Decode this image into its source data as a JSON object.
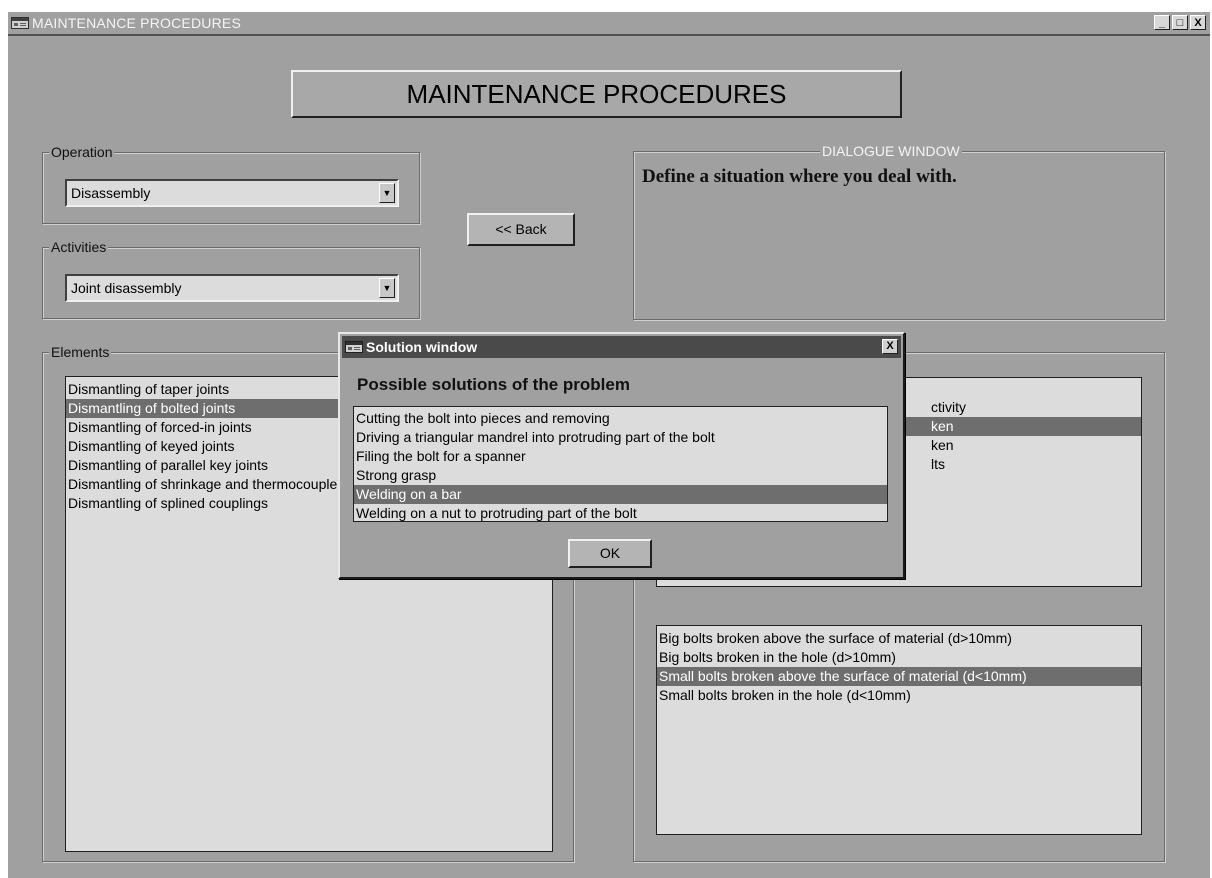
{
  "window": {
    "title": "MAINTENANCE PROCEDURES",
    "buttons": {
      "minimize": "_",
      "maximize": "□",
      "close": "X"
    }
  },
  "main_title": "MAINTENANCE PROCEDURES",
  "operation": {
    "label": "Operation",
    "selected": "Disassembly"
  },
  "activities": {
    "label": "Activities",
    "selected": "Joint disassembly"
  },
  "back_button": "<< Back",
  "dialogue": {
    "label": "DIALOGUE WINDOW",
    "text": "Define a situation where you deal with."
  },
  "elements": {
    "label": "Elements",
    "items": [
      "Dismantling of  taper joints",
      "Dismantling of bolted joints",
      "Dismantling of forced-in joints",
      "Dismantling of keyed joints",
      "Dismantling of parallel key joints",
      "Dismantling of shrinkage and thermocouple joints",
      "Dismantling of splined couplings"
    ],
    "selected_index": 1
  },
  "right_list_partial": {
    "items": [
      "ctivity",
      "ken",
      "ken",
      "lts"
    ],
    "selected_index": 1
  },
  "situations": {
    "items": [
      "Big bolts broken above the surface of material (d>10mm)",
      "Big bolts broken in the hole (d>10mm)",
      "Small bolts broken above the surface of material (d<10mm)",
      "Small bolts broken in the hole (d<10mm)"
    ],
    "selected_index": 2
  },
  "solution_window": {
    "title": "Solution window",
    "heading": "Possible solutions of the problem",
    "items": [
      "Cutting the bolt into pieces and removing",
      "Driving a triangular mandrel into protruding part of the bolt",
      "Filing the bolt for a spanner",
      "Strong grasp",
      "Welding on a bar",
      "Welding on a nut to protruding part of the bolt"
    ],
    "selected_index": 4,
    "ok_label": "OK",
    "close_label": "X"
  },
  "colors": {
    "face": "#a0a0a0",
    "list_bg": "#dcdcdc",
    "selection": "#6e6e6e",
    "modal_title": "#4a4a4a"
  },
  "icons": {
    "app": "app-window-icon"
  }
}
